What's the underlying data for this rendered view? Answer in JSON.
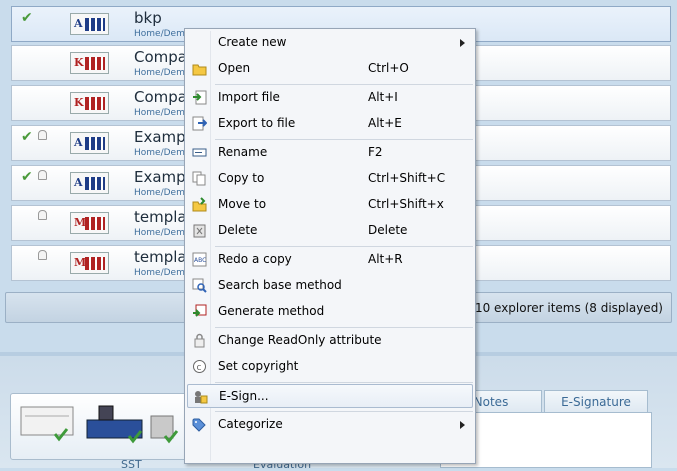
{
  "explorer": {
    "rows": [
      {
        "name": "bkp",
        "path": "Home/Demo",
        "check": true,
        "lock": false,
        "icon": "A",
        "color": "blue",
        "selected": true
      },
      {
        "name": "Compa",
        "path": "Home/Demo",
        "check": false,
        "lock": false,
        "icon": "K",
        "color": "red",
        "selected": false
      },
      {
        "name": "Compa",
        "path": "Home/Demo",
        "check": false,
        "lock": false,
        "icon": "K",
        "color": "red",
        "selected": false
      },
      {
        "name": "Exampl",
        "path": "Home/Demo",
        "check": true,
        "lock": true,
        "icon": "A",
        "color": "blue",
        "selected": false
      },
      {
        "name": "Exampl",
        "path": "Home/Demo",
        "check": true,
        "lock": true,
        "icon": "A",
        "color": "blue",
        "selected": false
      },
      {
        "name": "templa",
        "path": "Home/Demo",
        "check": false,
        "lock": true,
        "icon": "M",
        "color": "red",
        "selected": false
      },
      {
        "name": "templa",
        "path": "Home/Demo",
        "check": false,
        "lock": true,
        "icon": "M",
        "color": "red",
        "selected": false
      }
    ],
    "status": "10 explorer items (8 displayed)"
  },
  "context_menu": {
    "items": [
      {
        "label": "Create new",
        "shortcut": "",
        "icon": "blank",
        "submenu": true,
        "highlighted": false
      },
      {
        "label": "Open",
        "shortcut": "Ctrl+O",
        "icon": "folder-open-icon",
        "submenu": false,
        "highlighted": false
      },
      {
        "separator": true
      },
      {
        "label": "Import file",
        "shortcut": "Alt+I",
        "icon": "import-icon",
        "submenu": false,
        "highlighted": false
      },
      {
        "label": "Export to file",
        "shortcut": "Alt+E",
        "icon": "export-icon",
        "submenu": false,
        "highlighted": false
      },
      {
        "separator": true
      },
      {
        "label": "Rename",
        "shortcut": "F2",
        "icon": "rename-icon",
        "submenu": false,
        "highlighted": false
      },
      {
        "label": "Copy to",
        "shortcut": "Ctrl+Shift+C",
        "icon": "copy-icon",
        "submenu": false,
        "highlighted": false
      },
      {
        "label": "Move to",
        "shortcut": "Ctrl+Shift+x",
        "icon": "move-icon",
        "submenu": false,
        "highlighted": false
      },
      {
        "label": "Delete",
        "shortcut": "Delete",
        "icon": "delete-icon",
        "submenu": false,
        "highlighted": false
      },
      {
        "separator": true
      },
      {
        "label": "Redo a copy",
        "shortcut": "Alt+R",
        "icon": "redo-copy-icon",
        "submenu": false,
        "highlighted": false
      },
      {
        "label": "Search base method",
        "shortcut": "",
        "icon": "search-method-icon",
        "submenu": false,
        "highlighted": false
      },
      {
        "label": "Generate method",
        "shortcut": "",
        "icon": "generate-method-icon",
        "submenu": false,
        "highlighted": false
      },
      {
        "separator": true
      },
      {
        "label": "Change ReadOnly attribute",
        "shortcut": "",
        "icon": "lock-icon",
        "submenu": false,
        "highlighted": false
      },
      {
        "label": "Set copyright",
        "shortcut": "",
        "icon": "copyright-icon",
        "submenu": false,
        "highlighted": false
      },
      {
        "separator": true
      },
      {
        "label": "E-Sign...",
        "shortcut": "",
        "icon": "esign-icon",
        "submenu": false,
        "highlighted": true
      },
      {
        "separator": true
      },
      {
        "label": "Categorize",
        "shortcut": "",
        "icon": "tag-icon",
        "submenu": true,
        "highlighted": false
      }
    ]
  },
  "lower_panel": {
    "bottom_labels": [
      "SST",
      "Evaluation"
    ],
    "tabs": [
      {
        "label": "Notes"
      },
      {
        "label": "E-Signature"
      }
    ]
  }
}
